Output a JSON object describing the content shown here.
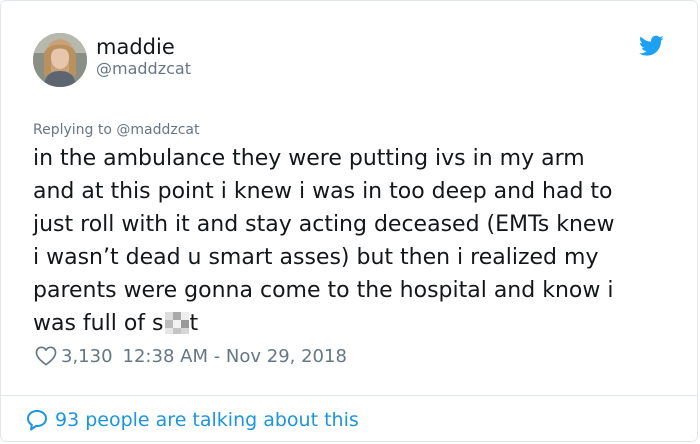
{
  "author": {
    "display_name": "maddie",
    "handle": "@maddzcat"
  },
  "reply_context": {
    "prefix": "Replying to ",
    "mention": "@maddzcat"
  },
  "tweet": {
    "lines": [
      "in the ambulance they were putting ivs in my arm",
      "and at this point i knew i was in too deep and had to",
      "just roll with it and stay acting deceased (EMTs knew",
      "i wasn’t dead u smart asses) but then i realized my",
      "parents were gonna come to the hospital and know i"
    ],
    "last_line_before": "was full of s",
    "last_line_after": "t"
  },
  "stats": {
    "likes": "3,130",
    "timestamp": "12:38 AM - Nov 29, 2018"
  },
  "footer": {
    "conversation_label": "93 people are talking about this"
  },
  "icons": {
    "brand": "twitter-bird-icon",
    "like": "heart-outline-icon",
    "reply": "speech-bubble-icon"
  },
  "colors": {
    "accent": "#1b95e0",
    "twitter_blue": "#1da1f2",
    "secondary_text": "#657786",
    "primary_text": "#14171a",
    "border": "#e1e8ed"
  }
}
